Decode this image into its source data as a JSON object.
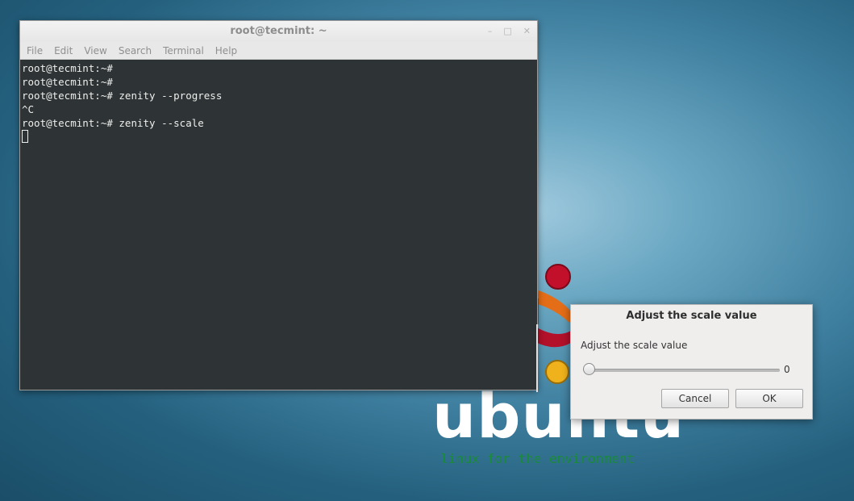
{
  "wallpaper": {
    "brand_word": "ubuntu",
    "tagline": "linux for the environment",
    "colors": {
      "red": "#c2102b",
      "orange": "#e46d17",
      "yellow": "#f0b21c",
      "green": "#1b8a3d"
    }
  },
  "terminal": {
    "title": "root@tecmint: ~",
    "window_controls": {
      "minimize": "–",
      "maximize": "□",
      "close": "✕"
    },
    "menu": [
      "File",
      "Edit",
      "View",
      "Search",
      "Terminal",
      "Help"
    ],
    "lines": [
      "root@tecmint:~#",
      "root@tecmint:~#",
      "root@tecmint:~# zenity --progress",
      "^C",
      "root@tecmint:~# zenity --scale"
    ]
  },
  "dialog": {
    "title": "Adjust the scale value",
    "label": "Adjust the scale value",
    "scale_value": "0",
    "scale_fraction": 0,
    "cancel_label": "Cancel",
    "ok_label": "OK"
  }
}
